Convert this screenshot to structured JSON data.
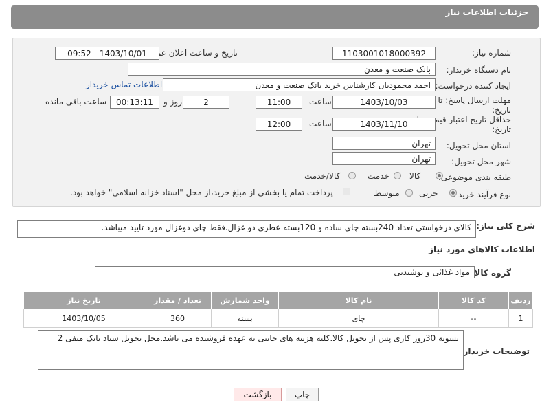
{
  "header": {
    "title": "جزئیات اطلاعات نیاز"
  },
  "fields": {
    "need_number_label": "شماره نیاز:",
    "need_number": "1103001018000392",
    "announce_label": "تاریخ و ساعت اعلان عمومی:",
    "announce_value": "1403/10/01 - 09:52",
    "buyer_org_label": "نام دستگاه خریدار:",
    "buyer_org": "بانک صنعت و معدن",
    "requester_label": "ایجاد کننده درخواست:",
    "requester": "احمد محمودیان کارشناس خرید بانک صنعت و معدن",
    "buyer_contact_link": "اطلاعات تماس خریدار",
    "deadline_label_1": "مهلت ارسال پاسخ: تا",
    "deadline_label_2": "تاریخ:",
    "deadline_date": "1403/10/03",
    "hour_label": "ساعت",
    "deadline_time": "11:00",
    "days_value": "2",
    "days_label": "روز و",
    "remaining_time": "00:13:11",
    "remaining_label": "ساعت باقی مانده",
    "price_validity_label_1": "حداقل تاریخ اعتبار قیمت: تا",
    "price_validity_label_2": "تاریخ:",
    "price_validity_date": "1403/11/10",
    "price_validity_time": "12:00",
    "province_label": "استان محل تحویل:",
    "province": "تهران",
    "city_label": "شهر محل تحویل:",
    "city": "تهران",
    "category_label": "طبقه بندی موضوعی:",
    "category_options": [
      "کالا",
      "خدمت",
      "کالا/خدمت"
    ],
    "process_label": "نوع فرآیند خرید :",
    "process_options": [
      "جزیی",
      "متوسط"
    ],
    "payment_note": "پرداخت تمام یا بخشی از مبلغ خرید،از محل \"اسناد خزانه اسلامی\" خواهد بود."
  },
  "description": {
    "label": "شرح کلی نیاز:",
    "text": "کالای درخواستی تعداد 240بسته چای ساده و 120بسته عطری دو غزال.فقط چای دوغزال مورد تایید میباشد."
  },
  "goods": {
    "section_title": "اطلاعات کالاهای مورد نیاز",
    "group_label": "گروه کالا:",
    "group_value": "مواد غذائی و نوشیدنی",
    "columns": [
      "ردیف",
      "کد کالا",
      "نام کالا",
      "واحد شمارش",
      "تعداد / مقدار",
      "تاریخ نیاز"
    ],
    "rows": [
      [
        "1",
        "--",
        "چای",
        "بسته",
        "360",
        "1403/10/05"
      ]
    ]
  },
  "buyer_notes": {
    "label": "توضیحات خریدار:",
    "text": "تسویه 30روز کاری پس از تحویل کالا.کلیه هزینه های جانبی به عهده فروشنده می باشد.محل تحویل ستاد بانک منفی 2"
  },
  "buttons": {
    "print": "چاپ",
    "back": "بازگشت"
  }
}
